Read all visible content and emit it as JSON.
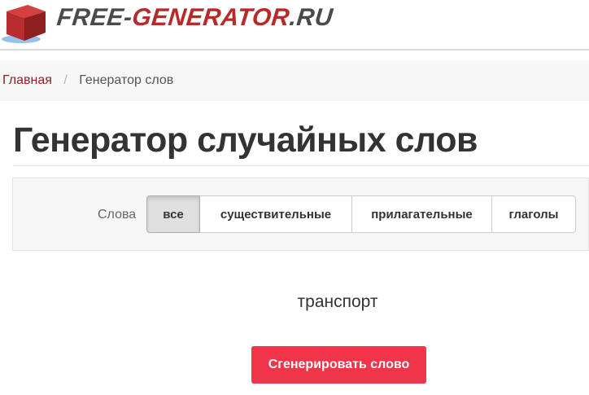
{
  "header": {
    "logo_text_part1": "FREE-",
    "logo_text_part2": "GENERATOR",
    "logo_text_part3": ".RU",
    "logo_icon": "red-cube-icon"
  },
  "breadcrumb": {
    "home": "Главная",
    "separator": "/",
    "current": "Генератор слов"
  },
  "page": {
    "title": "Генератор случайных слов"
  },
  "filter": {
    "label": "Слова",
    "options": [
      {
        "label": "все",
        "active": true
      },
      {
        "label": "существительные",
        "active": false
      },
      {
        "label": "прилагательные",
        "active": false
      },
      {
        "label": "глаголы",
        "active": false
      }
    ]
  },
  "result": {
    "word": "транспорт"
  },
  "actions": {
    "generate_label": "Сгенерировать слово"
  },
  "colors": {
    "brand_red": "#b72a2a",
    "generate_button": "#f0344a",
    "link": "#8b2424"
  }
}
